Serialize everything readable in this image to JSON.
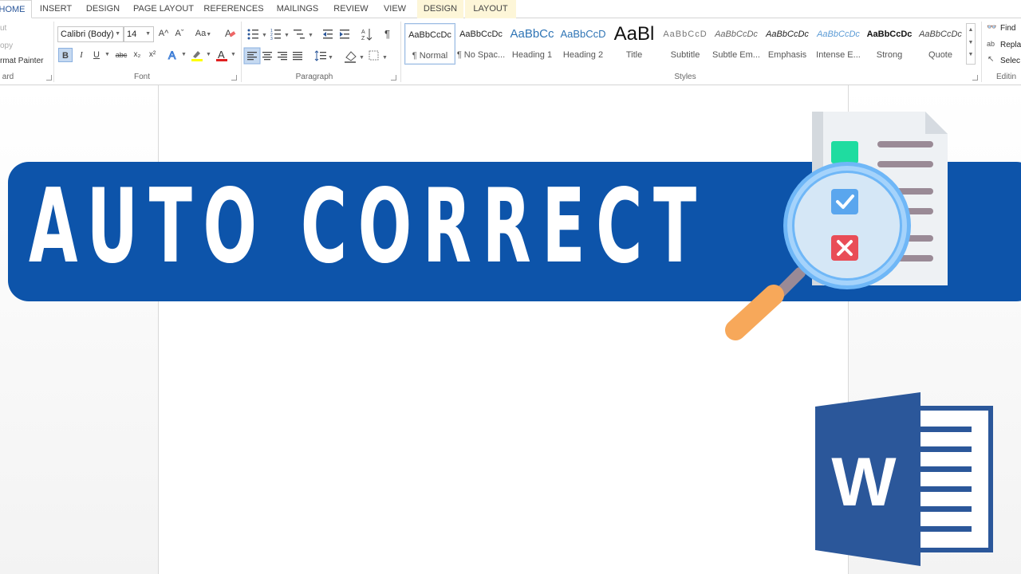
{
  "tabs": [
    "HOME",
    "INSERT",
    "DESIGN",
    "PAGE LAYOUT",
    "REFERENCES",
    "MAILINGS",
    "REVIEW",
    "VIEW",
    "DESIGN",
    "LAYOUT"
  ],
  "clipboard": {
    "cut_label": "ut",
    "copy_label": "opy",
    "format_painter_label": "rmat Painter",
    "group_label": "ard"
  },
  "font": {
    "family": "Calibri (Body)",
    "size": "14",
    "group_label": "Font",
    "bold": "B",
    "italic": "I",
    "underline": "U",
    "strike": "abc",
    "subscript": "x₂",
    "superscript": "x²",
    "grow": "A^",
    "shrink": "Aˇ",
    "change_case": "Aa",
    "font_color_letter": "A"
  },
  "paragraph": {
    "group_label": "Paragraph"
  },
  "styles": {
    "group_label": "Styles",
    "items": [
      {
        "preview": "AaBbCcDc",
        "name": "¶ Normal"
      },
      {
        "preview": "AaBbCcDc",
        "name": "¶ No Spac..."
      },
      {
        "preview": "AaBbCc",
        "name": "Heading 1"
      },
      {
        "preview": "AaBbCcD",
        "name": "Heading 2"
      },
      {
        "preview": "AaBl",
        "name": "Title"
      },
      {
        "preview": "AaBbCcD",
        "name": "Subtitle"
      },
      {
        "preview": "AaBbCcDc",
        "name": "Subtle Em..."
      },
      {
        "preview": "AaBbCcDc",
        "name": "Emphasis"
      },
      {
        "preview": "AaBbCcDc",
        "name": "Intense E..."
      },
      {
        "preview": "AaBbCcDc",
        "name": "Strong"
      },
      {
        "preview": "AaBbCcDc",
        "name": "Quote"
      }
    ]
  },
  "editing": {
    "group_label": "Editin",
    "find_label": "Find",
    "replace_label": "Repla",
    "select_label": "Selec"
  },
  "banner": {
    "title": "AUTO CORRECT"
  },
  "word_logo": {
    "letter": "W"
  },
  "colors": {
    "banner_blue": "#0d54aa",
    "word_blue": "#2b579a",
    "check_green": "#1fdca0",
    "cross_red": "#e94d57",
    "magnifier_handle": "#f7a85a",
    "lens_blue": "#6fb7f7"
  }
}
